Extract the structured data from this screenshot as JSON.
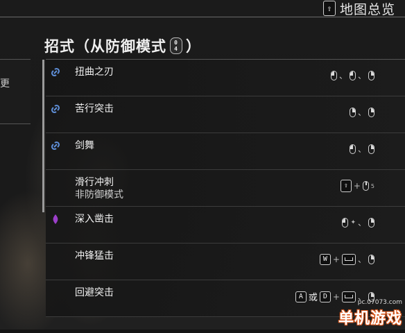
{
  "topbar": {
    "key_label": "⇧",
    "label": "地图总览"
  },
  "title": {
    "prefix": "招式（从防御模式",
    "key_top": "0",
    "key_bottom": "4",
    "suffix": "）"
  },
  "left_panel": {
    "text": "更"
  },
  "moves": [
    {
      "name": "扭曲之刃",
      "sub": "",
      "icon": "chain-link-icon",
      "input_text": "、 、"
    },
    {
      "name": "苦行突击",
      "sub": "",
      "icon": "chain-link-icon",
      "input_text": "、"
    },
    {
      "name": "剑舞",
      "sub": "",
      "icon": "chain-link-icon",
      "input_text": "、"
    },
    {
      "name": "滑行冲刺",
      "sub": "非防御模式",
      "icon": "",
      "input_text": "+"
    },
    {
      "name": "深入凿击",
      "sub": "",
      "icon": "purple-gem-icon",
      "input_text": "、"
    },
    {
      "name": "冲锋猛击",
      "sub": "",
      "icon": "",
      "input_text": "+ 、"
    },
    {
      "name": "回避突击",
      "sub": "",
      "icon": "",
      "input_text": "或 + 、"
    }
  ],
  "keys": {
    "w": "W",
    "a": "A",
    "d": "D",
    "shift": "⇧",
    "or": "或",
    "plus": "+",
    "comma": "、",
    "scroll_num": "5"
  },
  "colors": {
    "chain_icon": "#5f8fd8",
    "gem_icon": "#9b3fc9",
    "brand_outline": "#d9551a"
  },
  "watermark": {
    "url": "pc.07073.com",
    "brand": "单机游戏"
  }
}
